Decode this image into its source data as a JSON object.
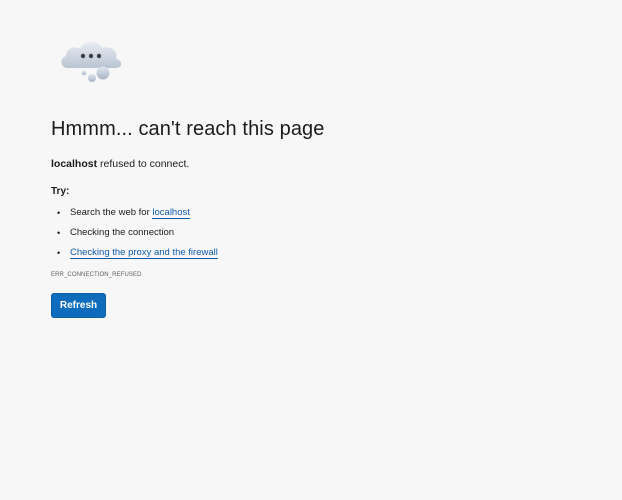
{
  "error_page": {
    "title": "Hmmm... can't reach this page",
    "host": "localhost",
    "subtitle_suffix": " refused to connect.",
    "try_label": "Try:",
    "suggestions": [
      {
        "prefix": "Search the web for ",
        "link": "localhost"
      },
      {
        "text": "Checking the connection"
      },
      {
        "link": "Checking the proxy and the firewall"
      }
    ],
    "error_code": "ERR_CONNECTION_REFUSED",
    "refresh_label": "Refresh",
    "icon": "cloud-error-icon"
  },
  "colors": {
    "background": "#f7f7f7",
    "link": "#0f5aa8",
    "button": "#0f6cbd",
    "text": "#1b1b1b"
  }
}
